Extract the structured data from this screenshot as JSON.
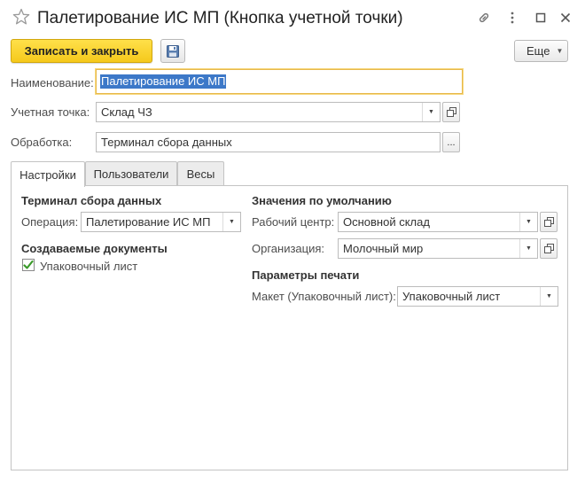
{
  "window": {
    "title": "Палетирование ИС МП (Кнопка учетной точки)"
  },
  "toolbar": {
    "save_close_label": "Записать и закрыть",
    "more_label": "Еще"
  },
  "form": {
    "name_label": "Наименование:",
    "name_value": "Палетирование ИС МП",
    "account_point_label": "Учетная точка:",
    "account_point_value": "Склад ЧЗ",
    "processing_label": "Обработка:",
    "processing_value": "Терминал сбора данных",
    "processing_button": "..."
  },
  "tabs": [
    {
      "label": "Настройки",
      "active": true
    },
    {
      "label": "Пользователи",
      "active": false
    },
    {
      "label": "Весы",
      "active": false
    }
  ],
  "settings": {
    "terminal_section": "Терминал сбора данных",
    "operation_label": "Операция:",
    "operation_value": "Палетирование ИС МП",
    "documents_section": "Создаваемые документы",
    "packing_list_label": "Упаковочный лист",
    "packing_list_checked": true,
    "defaults_section": "Значения по умолчанию",
    "work_center_label": "Рабочий центр:",
    "work_center_value": "Основной склад",
    "organization_label": "Организация:",
    "organization_value": "Молочный мир",
    "print_section": "Параметры печати",
    "layout_label": "Макет (Упаковочный лист):",
    "layout_value": "Упаковочный лист"
  },
  "colors": {
    "primary_button": "#f5c91b",
    "focus_border": "#e7b94c",
    "selection": "#3c78c8",
    "checkmark": "#3a9a2a"
  }
}
